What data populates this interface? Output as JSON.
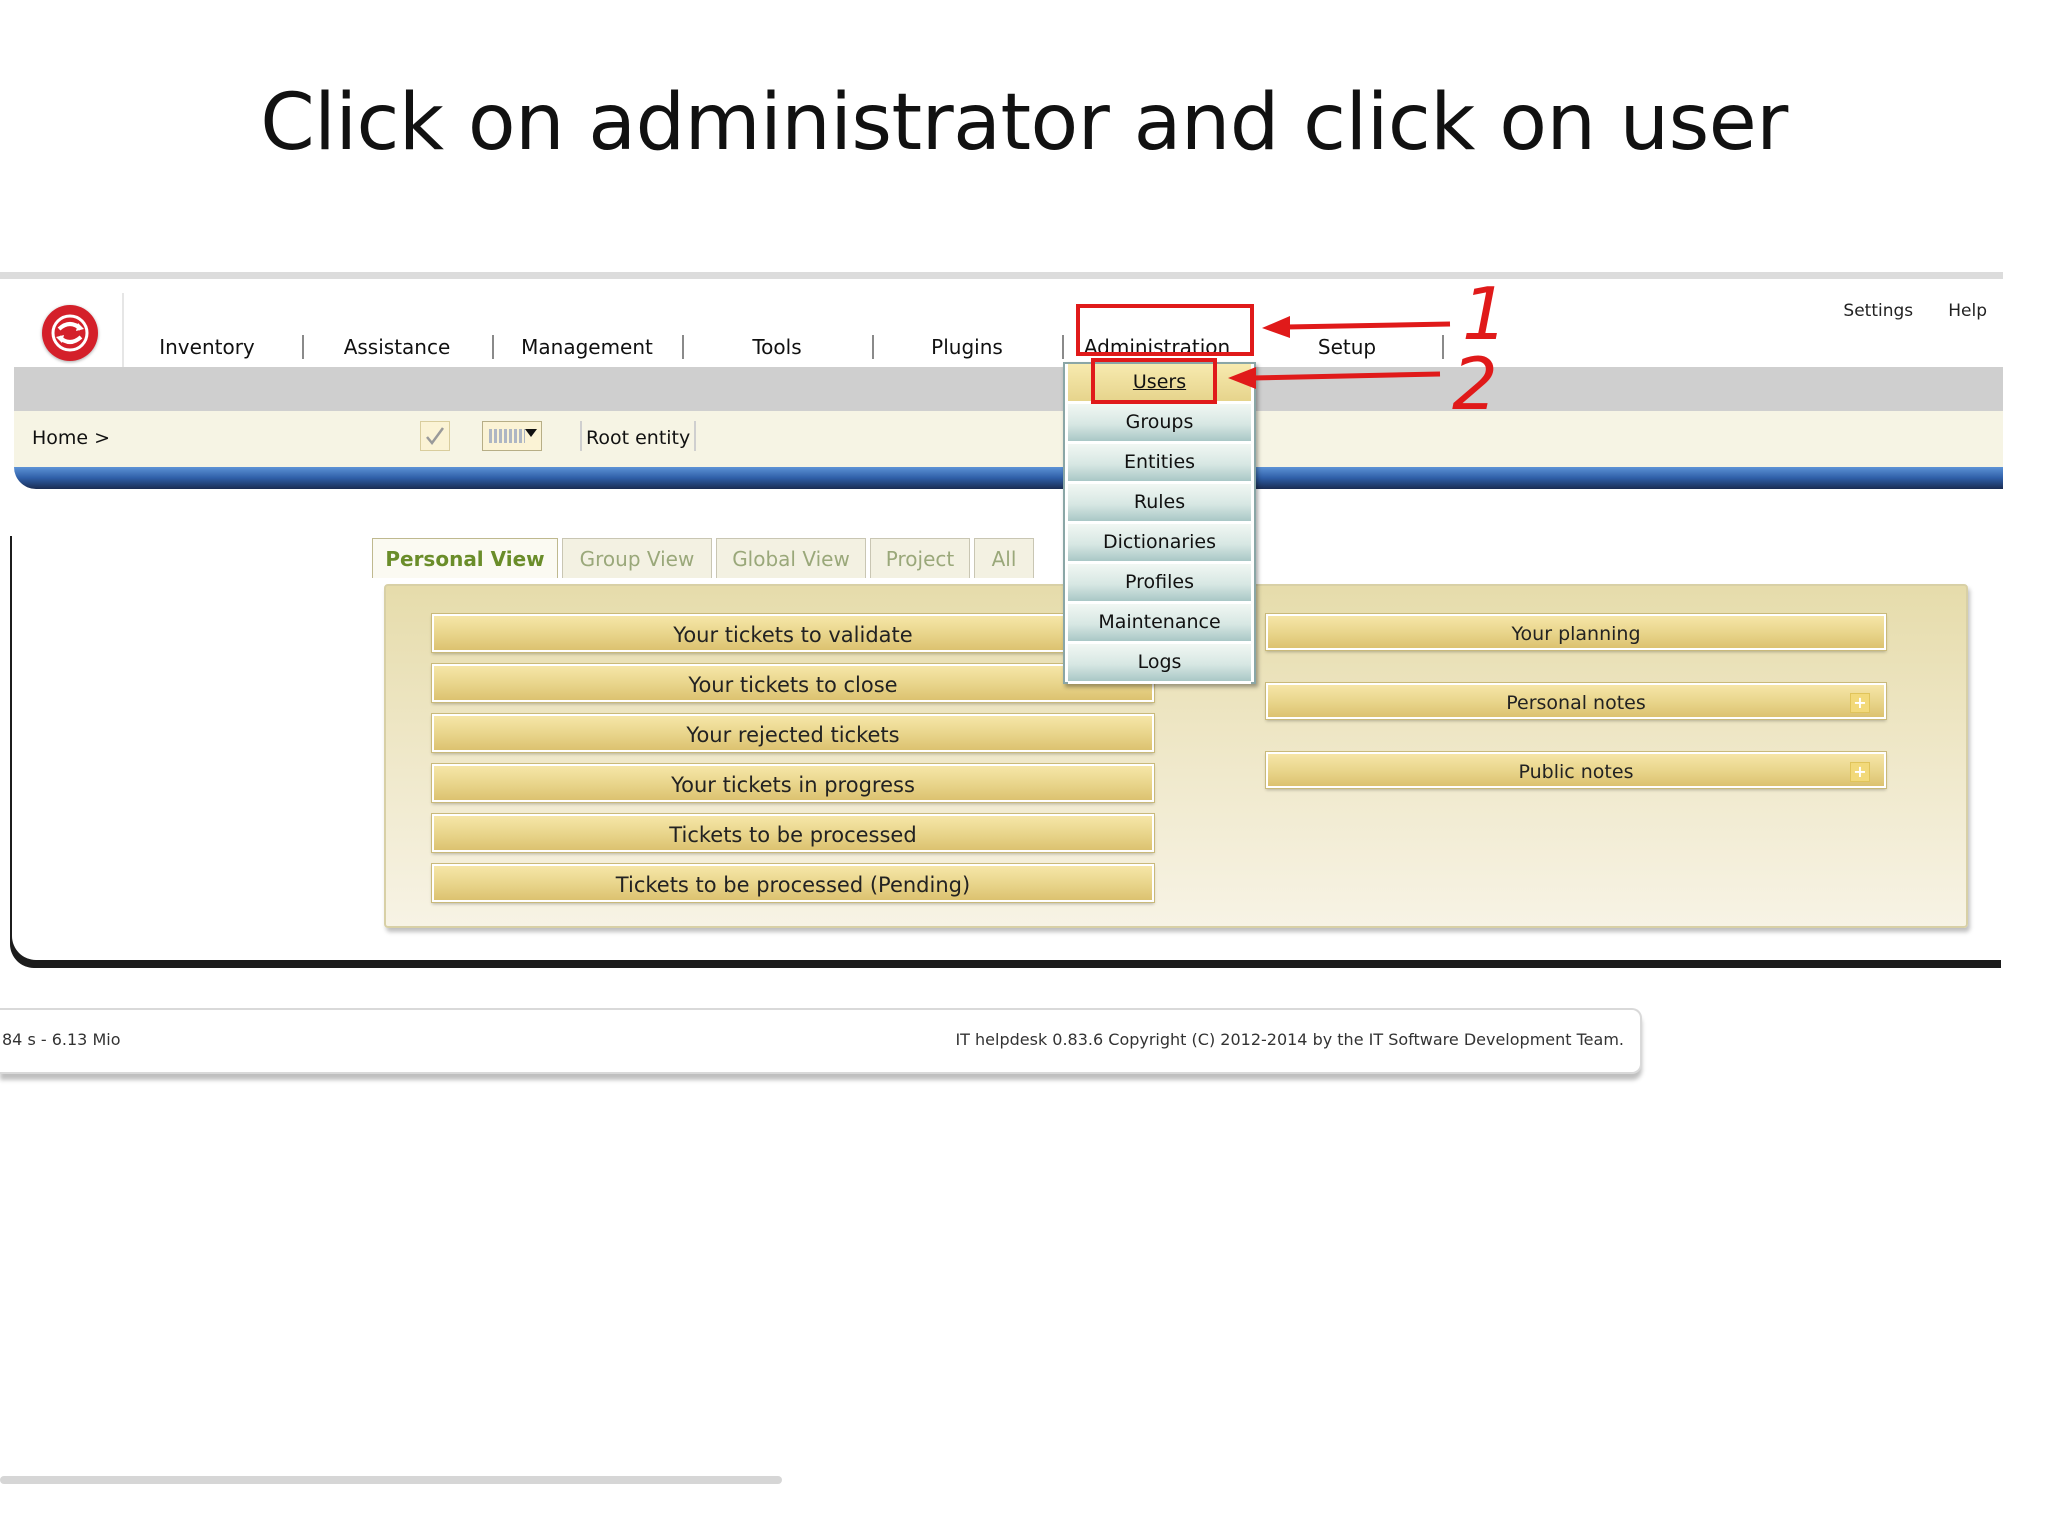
{
  "slide": {
    "title": "Click on administrator and click on user"
  },
  "header": {
    "logo": "app-logo-icon",
    "nav": [
      "Inventory",
      "Assistance",
      "Management",
      "Tools",
      "Plugins",
      "Administration",
      "Setup"
    ],
    "top_links": [
      "Settings",
      "Help"
    ],
    "breadcrumb": "Home >",
    "entity": "Root entity"
  },
  "admin_menu": {
    "items": [
      "Users",
      "Groups",
      "Entities",
      "Rules",
      "Dictionaries",
      "Profiles",
      "Maintenance",
      "Logs"
    ],
    "highlight": "#e01a1a"
  },
  "annotations": {
    "step1": "1",
    "step2": "2"
  },
  "tabs": {
    "items": [
      "Personal View",
      "Group View",
      "Global View",
      "Project",
      "All"
    ],
    "active": "Personal View"
  },
  "tickets": [
    "Your tickets to validate",
    "Your tickets to close",
    "Your rejected tickets",
    "Your tickets in progress",
    "Tickets to be processed",
    "Tickets to be processed (Pending)"
  ],
  "right_panels": [
    "Your planning",
    "Personal notes",
    "Public notes"
  ],
  "footer": {
    "left": "84 s - 6.13 Mio",
    "right": "IT helpdesk 0.83.6 Copyright (C) 2012-2014 by the IT Software Development Team."
  },
  "colors": {
    "accent_red": "#e01a1a",
    "tab_active": "#6a8d2a",
    "panel_bg": "#e6dcab"
  }
}
